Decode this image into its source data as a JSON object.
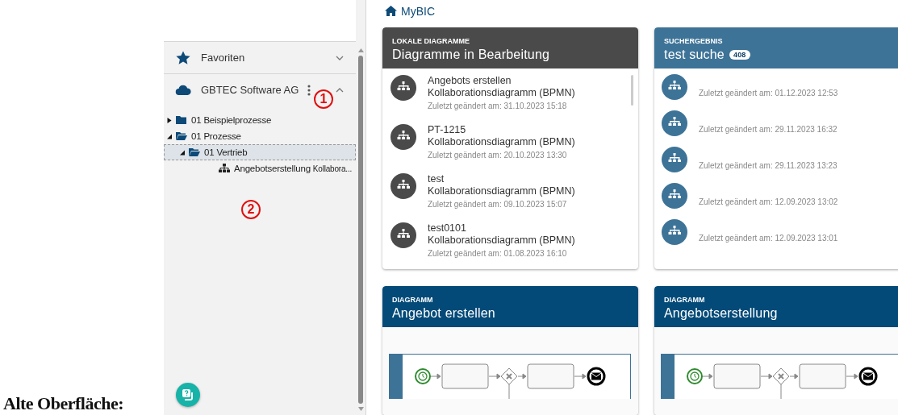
{
  "caption": "Alte Oberfläche:",
  "sidebar": {
    "sections": [
      {
        "kind": "favorites",
        "label": "Favoriten",
        "expanded": false
      },
      {
        "kind": "cloud",
        "label": "GBTEC Software AG",
        "expanded": true
      }
    ],
    "tree": [
      {
        "kind": "folder",
        "label": "01 Beispielprozesse",
        "expanded": false,
        "selected": false
      },
      {
        "kind": "folder",
        "label": "01 Prozesse",
        "expanded": true,
        "selected": false,
        "children": [
          {
            "kind": "folder",
            "label": "01 Vertrieb",
            "expanded": true,
            "selected": true,
            "children": [
              {
                "kind": "diagram",
                "label": "Angebotserstellung",
                "type": "Kollabora...",
                "selected": false
              }
            ]
          }
        ]
      }
    ],
    "annotations": [
      "1",
      "2"
    ]
  },
  "breadcrumb": "MyBIC",
  "cards": [
    {
      "kind": "list",
      "color": "#4a4a4a",
      "overline": "LOKALE DIAGRAMME",
      "title": "Diagramme in Bearbeitung",
      "items": [
        {
          "name": "Angebots erstellen",
          "type": "Kollaborationsdiagramm (BPMN)",
          "modified": "Zuletzt geändert am: 31.10.2023 15:18"
        },
        {
          "name": "PT-1215",
          "type": "Kollaborationsdiagramm (BPMN)",
          "modified": "Zuletzt geändert am: 20.10.2023 13:30"
        },
        {
          "name": "test",
          "type": "Kollaborationsdiagramm (BPMN)",
          "modified": "Zuletzt geändert am: 09.10.2023 15:07"
        },
        {
          "name": "test0101",
          "type": "Kollaborationsdiagramm (BPMN)",
          "modified": "Zuletzt geändert am: 01.08.2023 16:10"
        }
      ]
    },
    {
      "kind": "list",
      "color": "#3d7397",
      "overline": "SUCHERGEBNIS",
      "title": "test suche",
      "count": "408",
      "items": [
        {
          "modified": "Zuletzt geändert am: 01.12.2023 12:53"
        },
        {
          "modified": "Zuletzt geändert am: 29.11.2023 16:32"
        },
        {
          "modified": "Zuletzt geändert am: 29.11.2023 13:23"
        },
        {
          "modified": "Zuletzt geändert am: 12.09.2023 13:02"
        },
        {
          "modified": "Zuletzt geändert am: 12.09.2023 13:01"
        }
      ]
    },
    {
      "kind": "diagram",
      "color": "#034a78",
      "overline": "DIAGRAMM",
      "title": "Angebot erstellen"
    },
    {
      "kind": "diagram",
      "color": "#034a78",
      "overline": "DIAGRAMM",
      "title": "Angebotserstellung"
    }
  ]
}
